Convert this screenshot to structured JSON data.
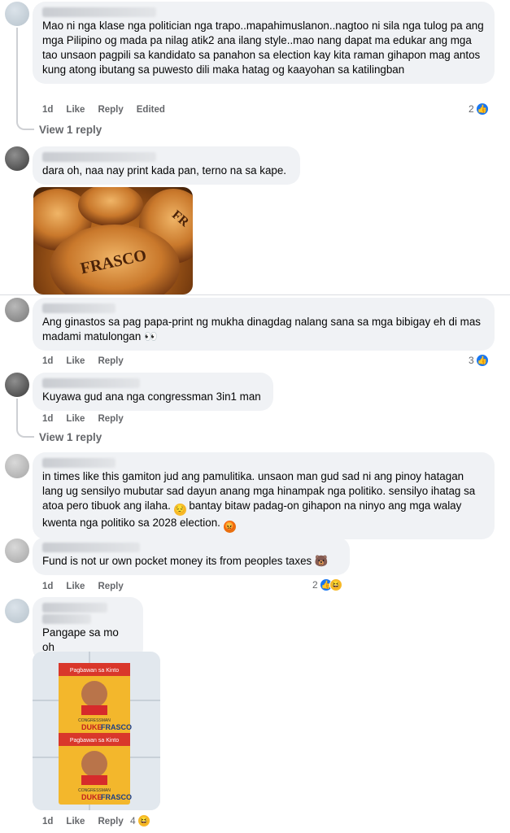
{
  "comments": [
    {
      "text": "Mao ni nga klase nga politician nga trapo..mapahimuslanon..nagtoo ni sila nga tulog pa ang mga Pilipino og mada pa nilag atik2 ana ilang style..mao nang dapat ma edukar ang mga tao unsaon pagpili sa kandidato sa panahon sa election kay kita raman gihapon mag antos kung atong ibutang sa puwesto dili maka hatag og kaayohan sa katilingban",
      "time": "1d",
      "like": "Like",
      "reply": "Reply",
      "edited": "Edited",
      "reaction_count": "2",
      "reactions": [
        "like-icon"
      ],
      "view_replies": "View 1 reply"
    },
    {
      "text": "dara oh, naa nay print kada pan, terno na sa kape.",
      "image": "frasco-bread-photo"
    },
    {
      "text": "Ang ginastos sa pag papa-print ng mukha dinagdag nalang sana sa mga bibigay eh di mas madami matulongan 👀",
      "time": "1d",
      "like": "Like",
      "reply": "Reply",
      "reaction_count": "3",
      "reactions": [
        "like-icon"
      ]
    },
    {
      "text": "Kuyawa gud ana nga congressman 3in1 man",
      "time": "1d",
      "like": "Like",
      "reply": "Reply",
      "view_replies": "View 1 reply"
    },
    {
      "text_a": "in times like this gamiton jud ang pamulitika. unsaon man gud sad ni ang pinoy hatagan lang ug sensilyo mubutar sad dayun anang mga hinampak nga politiko. sensilyo ihatag sa atoa pero tibuok ang ilaha.",
      "text_b": "bantay bitaw padag-on gihapon na ninyo ang mga walay kwenta nga politiko sa 2028 election."
    },
    {
      "text": "Fund is not ur own pocket money its from peoples taxes 🐻",
      "time": "1d",
      "like": "Like",
      "reply": "Reply",
      "reaction_count": "2",
      "reactions": [
        "like-icon",
        "haha-icon"
      ]
    },
    {
      "text": "Pangape sa mo oh",
      "image": "frasco-coffee-sachet-photo",
      "time": "1d",
      "like": "Like",
      "reply": "Reply",
      "reaction_count": "4",
      "reactions": [
        "haha-icon"
      ]
    }
  ],
  "images": {
    "bread_label_1": "FRASCO",
    "bread_label_2": "FR",
    "sachet_title": "Pagbawan sa Kinto",
    "sachet_sub": "CONGRESSMAN",
    "sachet_name_1": "DUKE",
    "sachet_name_2": "FRASCO"
  },
  "colors": {
    "bubble": "#f0f2f5",
    "like_blue": "#1877f2",
    "meta_gray": "#65676b",
    "haha_yellow": "#f7b928"
  }
}
